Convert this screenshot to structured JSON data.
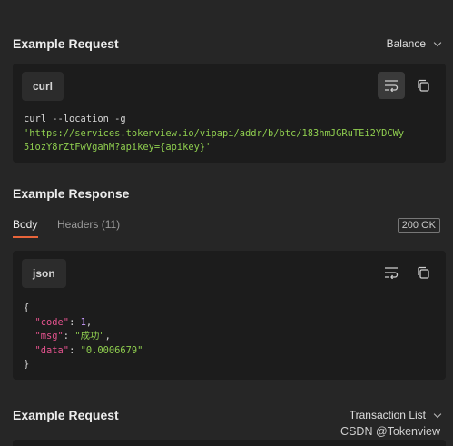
{
  "request": {
    "title": "Example Request",
    "dropdown_label": "Balance",
    "lang": "curl",
    "code_line1": "curl --location -g",
    "code_line2": "'https://services.tokenview.io/vipapi/addr/b/btc/183hmJGRuTEi2YDCWy",
    "code_line3": "5iozY8rZtFwVgahM?apikey={apikey}'"
  },
  "response": {
    "title": "Example Response",
    "tab_body": "Body",
    "tab_headers": "Headers (11)",
    "status": "200 OK",
    "lang": "json",
    "open_brace": "{",
    "close_brace": "}",
    "key_code": "\"code\"",
    "val_code": "1",
    "key_msg": "\"msg\"",
    "val_msg": "\"成功\"",
    "key_data": "\"data\"",
    "val_data": "\"0.0006679\""
  },
  "request2": {
    "title": "Example Request",
    "dropdown_label": "Transaction List"
  },
  "watermark": "CSDN @Tokenview",
  "icons": [
    "wrap-lines-icon",
    "copy-icon",
    "chevron-down-icon"
  ],
  "colors": {
    "background": "#262626",
    "panel": "#1c1c1c",
    "string": "#8fce4f",
    "key": "#e6538f",
    "number": "#c99bff",
    "accent": "#e8643a"
  }
}
